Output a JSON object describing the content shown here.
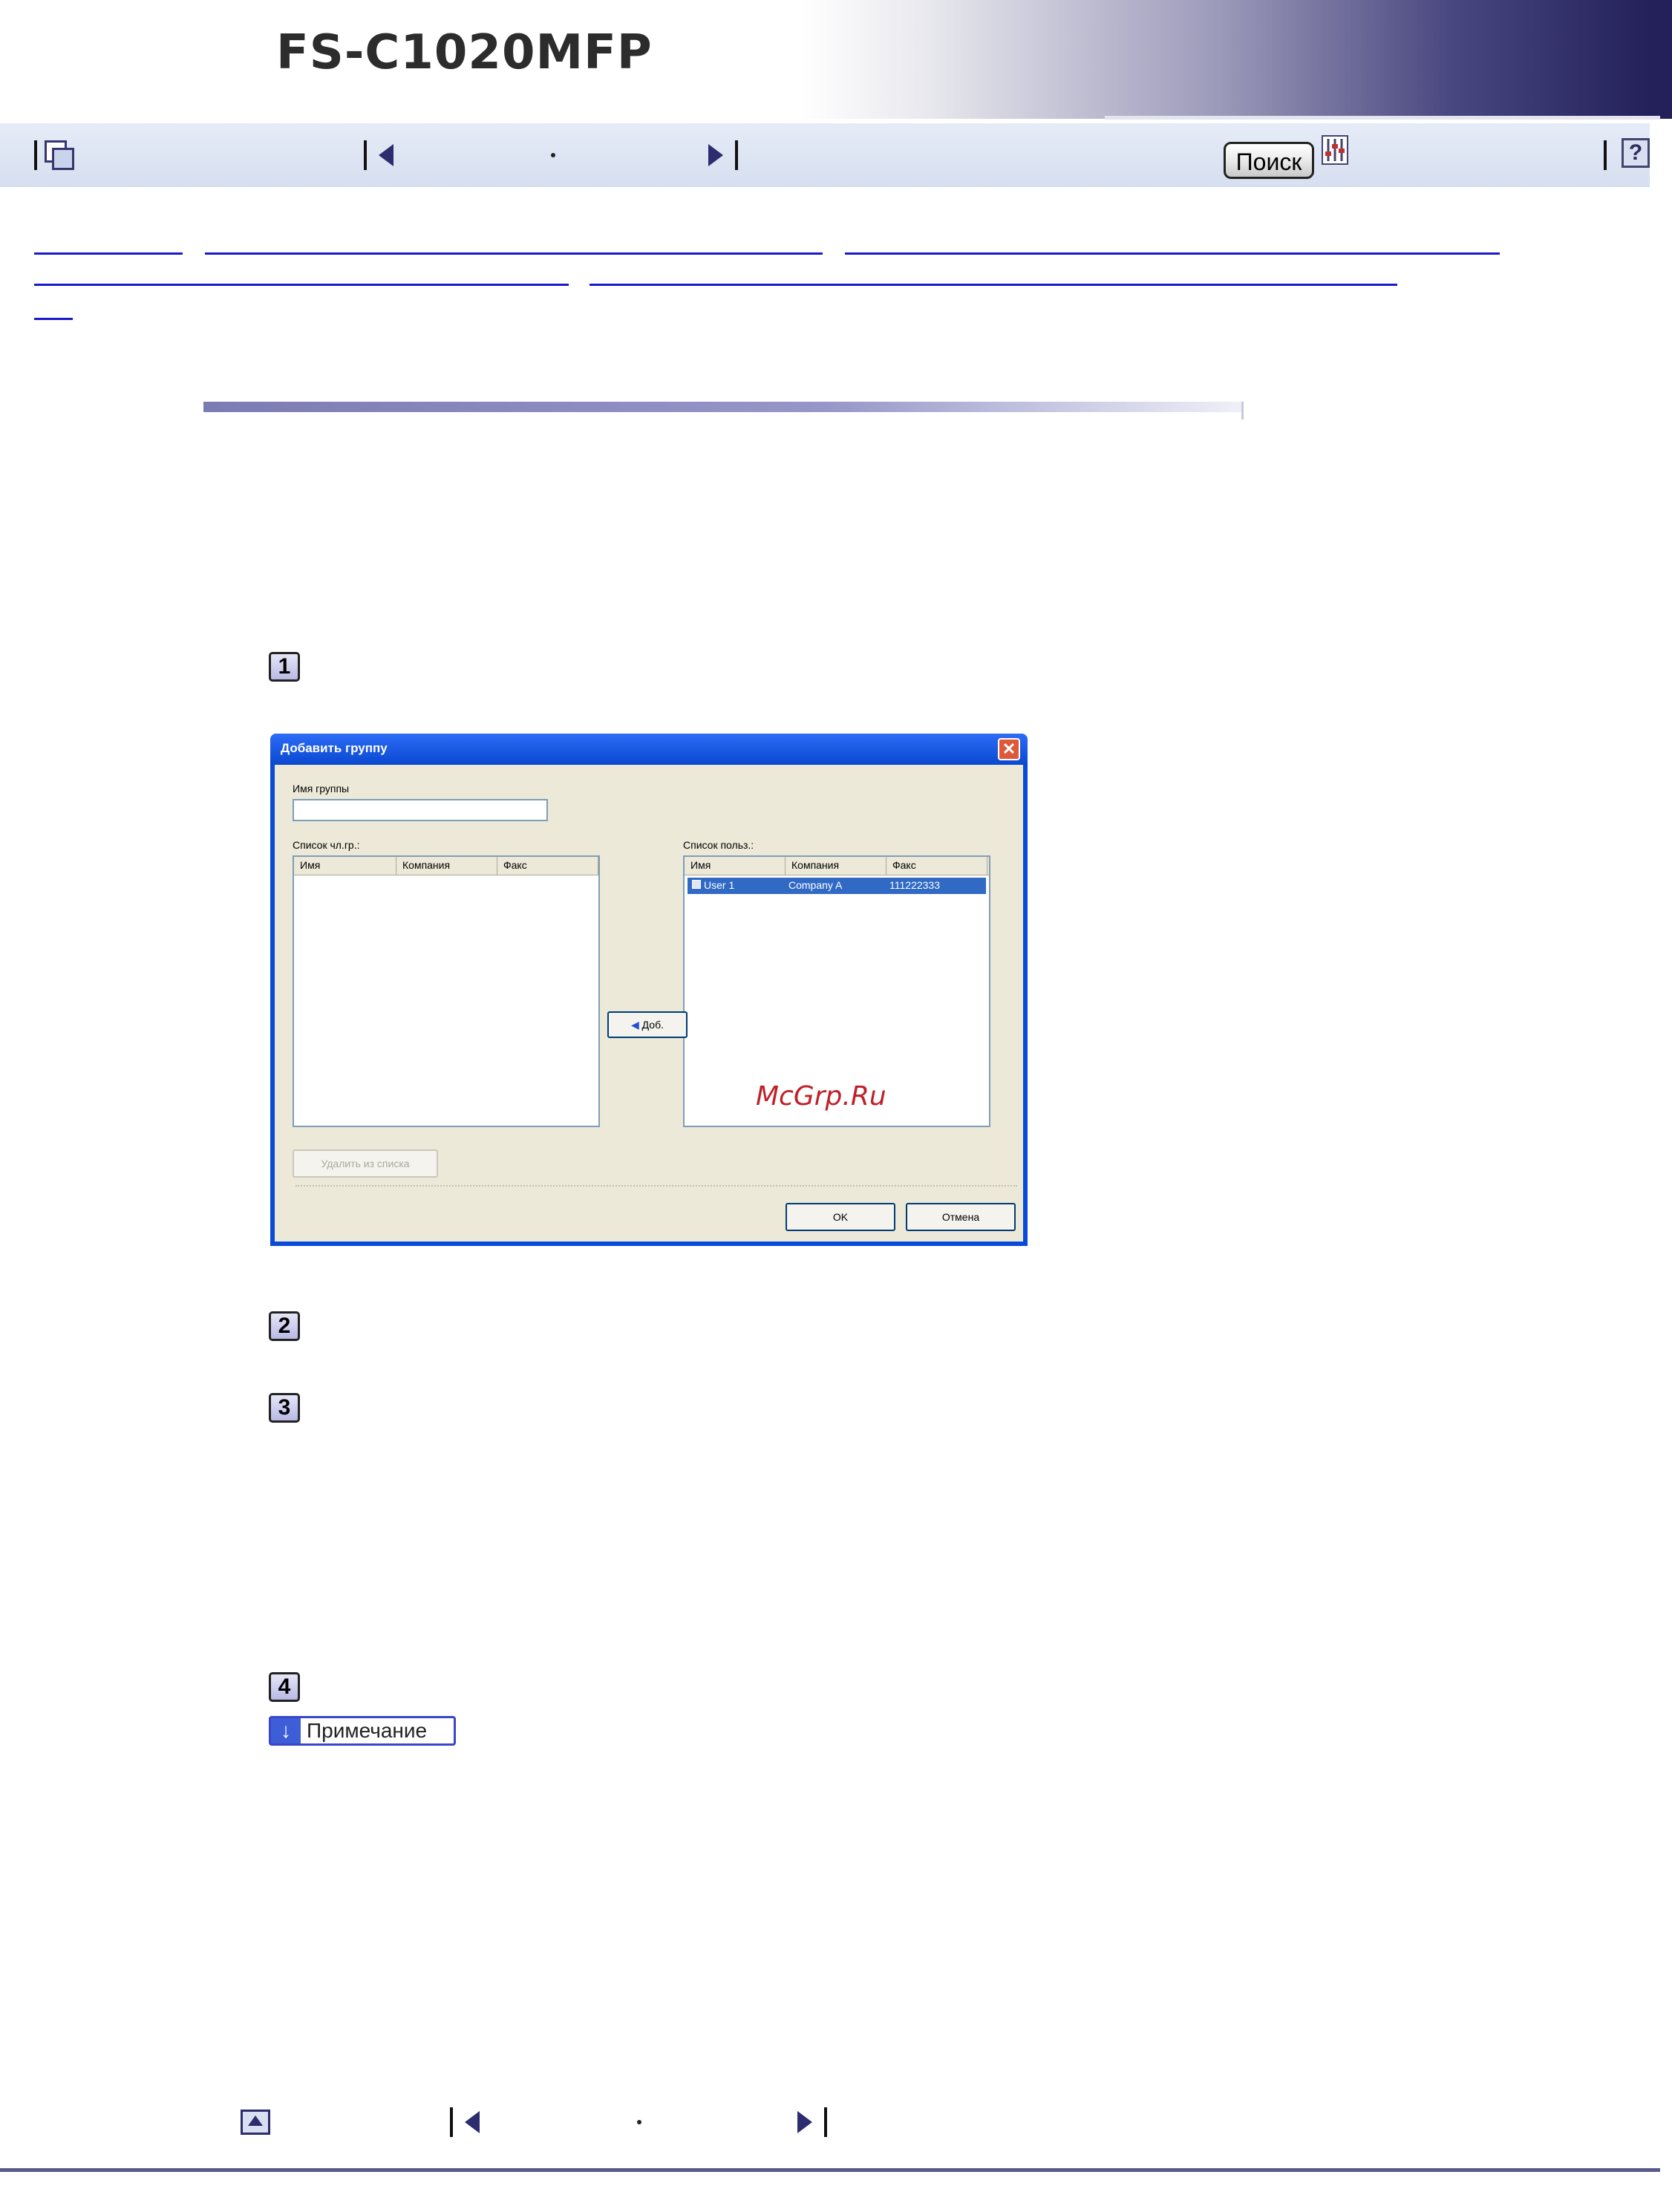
{
  "header": {
    "title": "FS-C1020MFP"
  },
  "navbar": {
    "prev_symbol": "◀",
    "middle_symbol": "·",
    "next_symbol": "▶",
    "search_label": "Поиск",
    "help_symbol": "?"
  },
  "steps": [
    "1",
    "2",
    "3",
    "4"
  ],
  "dialog": {
    "title": "Добавить группу",
    "close_symbol": "✕",
    "group_name_label": "Имя группы",
    "group_name_value": "",
    "members_label": "Список чл.гр.:",
    "users_label": "Список польз.:",
    "columns": [
      "Имя",
      "Компания",
      "Факс"
    ],
    "users": [
      {
        "name": "User 1",
        "company": "Company A",
        "fax": "111222333"
      }
    ],
    "add_button": "Доб.",
    "remove_button": "Удалить из списка",
    "ok_button": "OK",
    "cancel_button": "Отмена"
  },
  "watermark": "McGrp.Ru",
  "note": {
    "label": "Примечание"
  },
  "footer": {
    "middle_symbol": "·"
  }
}
